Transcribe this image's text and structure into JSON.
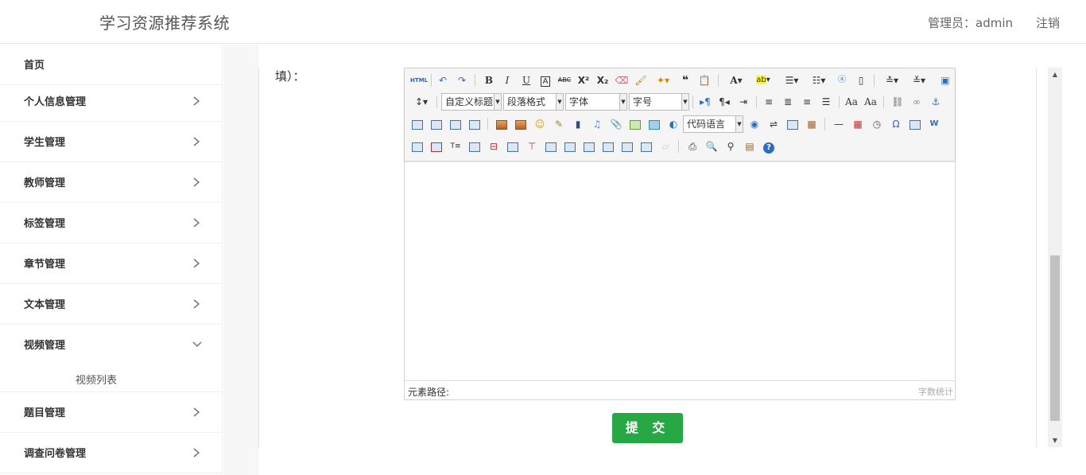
{
  "header": {
    "title": "学习资源推荐系统",
    "admin_text": "管理员：admin",
    "logout": "注销"
  },
  "sidebar": {
    "items": [
      {
        "label": "首页"
      },
      {
        "label": "个人信息管理"
      },
      {
        "label": "学生管理"
      },
      {
        "label": "教师管理"
      },
      {
        "label": "标签管理"
      },
      {
        "label": "章节管理"
      },
      {
        "label": "文本管理"
      },
      {
        "label": "视频管理"
      },
      {
        "label": "题目管理"
      },
      {
        "label": "调查问卷管理"
      }
    ],
    "submenu": {
      "video_list": "视频列表"
    }
  },
  "form": {
    "field_label": "填）："
  },
  "editor": {
    "toolbar": {
      "html_btn": "HTML",
      "custom_heading": "自定义标题",
      "paragraph_format": "段落格式",
      "font_family": "字体",
      "font_size": "字号",
      "code_language": "代码语言"
    },
    "status_path_label": "元素路径:",
    "word_count_label": "字数统计"
  },
  "submit_label": "提 交"
}
